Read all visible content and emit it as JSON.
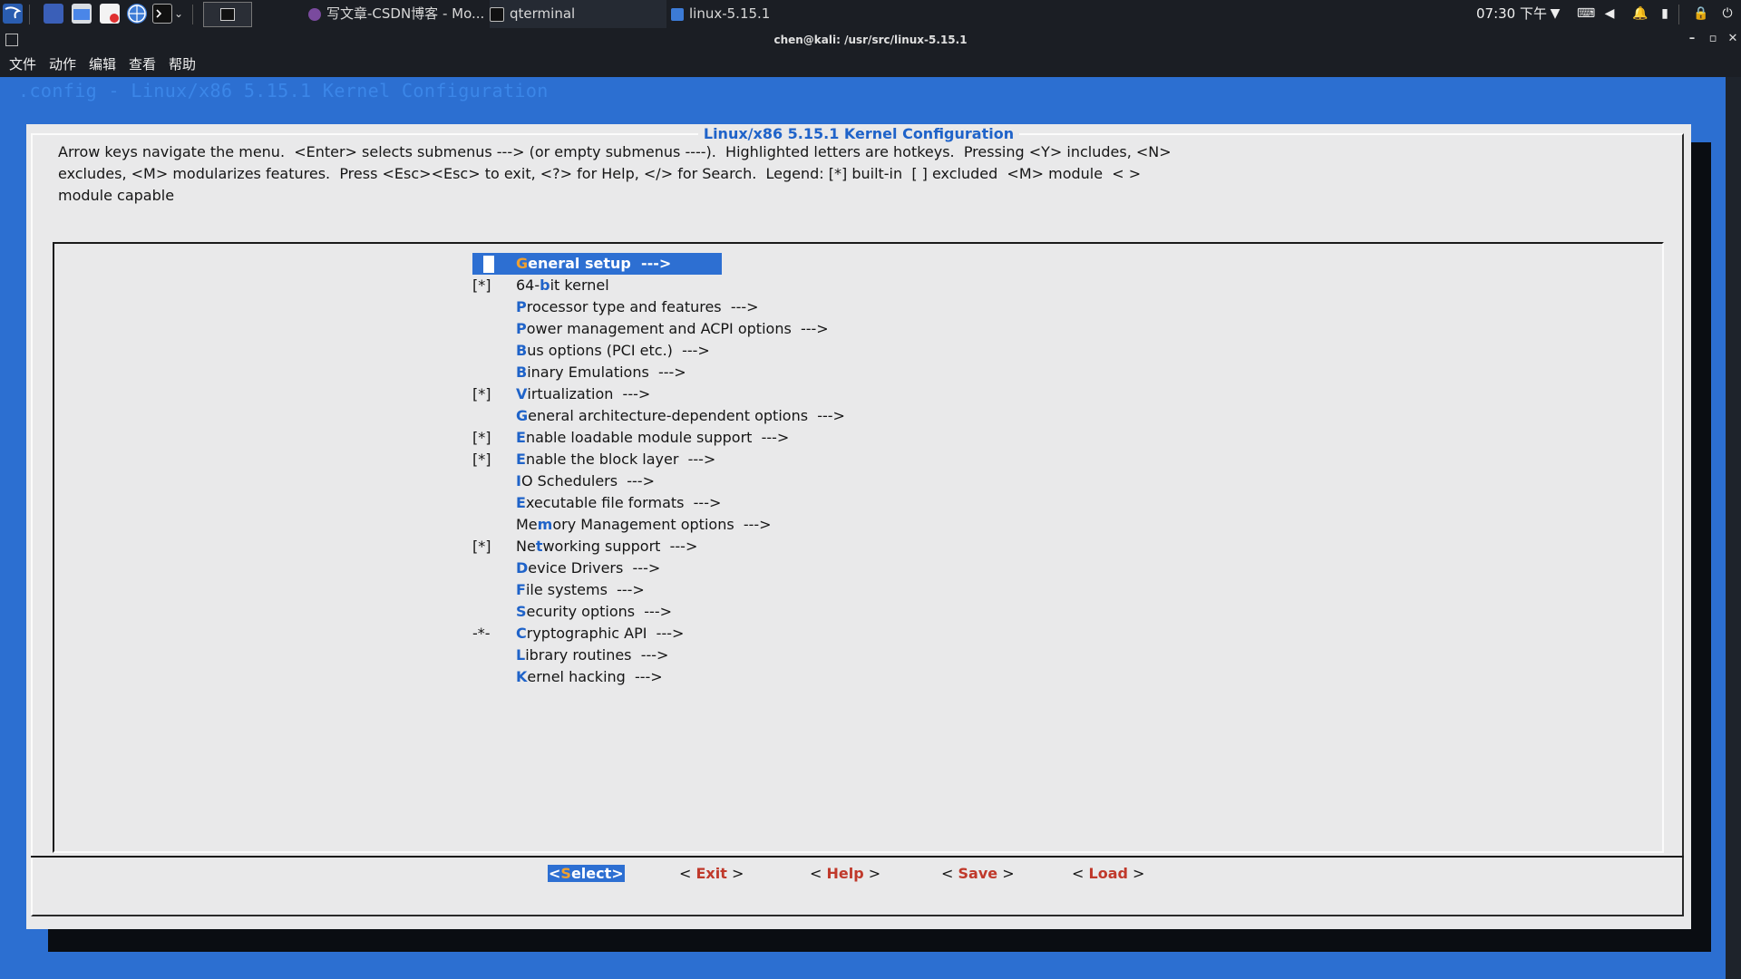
{
  "taskbar": {
    "tasks": [
      {
        "label": "写文章-CSDN博客 - Mo..."
      },
      {
        "label": "qterminal"
      },
      {
        "label": "linux-5.15.1"
      }
    ],
    "clock": "07:30 下午"
  },
  "window": {
    "title": "chen@kali: /usr/src/linux-5.15.1"
  },
  "menubar": {
    "items": [
      "文件",
      "动作",
      "编辑",
      "查看",
      "帮助"
    ]
  },
  "terminal": {
    "bg_title": ".config - Linux/x86 5.15.1 Kernel Configuration",
    "dialog_title": "Linux/x86 5.15.1 Kernel Configuration",
    "help_lines": [
      "Arrow keys navigate the menu.  <Enter> selects submenus ---> (or empty submenus ----).  Highlighted letters are hotkeys.  Pressing <Y> includes, <N>",
      "excludes, <M> modularizes features.  Press <Esc><Esc> to exit, <?> for Help, </> for Search.  Legend: [*] built-in  [ ] excluded  <M> module  < >",
      "module capable"
    ],
    "menu": [
      {
        "tag": "",
        "hotkey": "G",
        "rest": "eneral setup",
        "arrow": "--->",
        "selected": true
      },
      {
        "tag": "[*]",
        "pre": "64-",
        "hotkey": "b",
        "rest": "it kernel",
        "arrow": ""
      },
      {
        "tag": "",
        "hotkey": "P",
        "rest": "rocessor type and features",
        "arrow": "--->"
      },
      {
        "tag": "",
        "hotkey": "P",
        "rest": "ower management and ACPI options",
        "arrow": "--->"
      },
      {
        "tag": "",
        "hotkey": "B",
        "rest": "us options (PCI etc.)",
        "arrow": "--->"
      },
      {
        "tag": "",
        "hotkey": "B",
        "rest": "inary Emulations",
        "arrow": "--->"
      },
      {
        "tag": "[*]",
        "hotkey": "V",
        "rest": "irtualization",
        "arrow": "--->"
      },
      {
        "tag": "",
        "hotkey": "G",
        "rest": "eneral architecture-dependent options",
        "arrow": "--->"
      },
      {
        "tag": "[*]",
        "hotkey": "E",
        "rest": "nable loadable module support",
        "arrow": "--->"
      },
      {
        "tag": "[*]",
        "hotkey": "E",
        "rest": "nable the block layer",
        "arrow": "--->"
      },
      {
        "tag": "",
        "hotkey": "I",
        "rest": "O Schedulers",
        "arrow": "--->"
      },
      {
        "tag": "",
        "hotkey": "E",
        "rest": "xecutable file formats",
        "arrow": "--->"
      },
      {
        "tag": "",
        "pre": "Me",
        "hotkey": "m",
        "rest": "ory Management options",
        "arrow": "--->"
      },
      {
        "tag": "[*]",
        "pre": "Ne",
        "hotkey": "t",
        "rest": "working support",
        "arrow": "--->"
      },
      {
        "tag": "",
        "hotkey": "D",
        "rest": "evice Drivers",
        "arrow": "--->"
      },
      {
        "tag": "",
        "hotkey": "F",
        "rest": "ile systems",
        "arrow": "--->"
      },
      {
        "tag": "",
        "hotkey": "S",
        "rest": "ecurity options",
        "arrow": "--->"
      },
      {
        "tag": "-*-",
        "hotkey": "C",
        "rest": "ryptographic API",
        "arrow": "--->"
      },
      {
        "tag": "",
        "hotkey": "L",
        "rest": "ibrary routines",
        "arrow": "--->"
      },
      {
        "tag": "",
        "hotkey": "K",
        "rest": "ernel hacking",
        "arrow": "--->"
      }
    ],
    "buttons": [
      {
        "label": "Select",
        "active": true
      },
      {
        "label": "Exit"
      },
      {
        "label": "Help"
      },
      {
        "label": "Save"
      },
      {
        "label": "Load"
      }
    ]
  },
  "icons": [
    "kali-menu-icon",
    "desktop-icon",
    "file-manager-icon",
    "text-editor-icon",
    "browser-icon",
    "terminal-icon",
    "chevron-down-icon",
    "terminal-window-icon",
    "firefox-icon",
    "qterminal-icon",
    "folder-icon",
    "network-icon",
    "keyboard-icon",
    "volume-icon",
    "bell-icon",
    "battery-icon",
    "lock-icon",
    "power-icon"
  ],
  "colors": {
    "terminal_bg": "#2c6fd1",
    "dialog_bg": "#e9e9ea",
    "accent": "#1f63c9",
    "hotkey_btn": "#c0392b",
    "selected_hotkey": "#f0a030"
  }
}
